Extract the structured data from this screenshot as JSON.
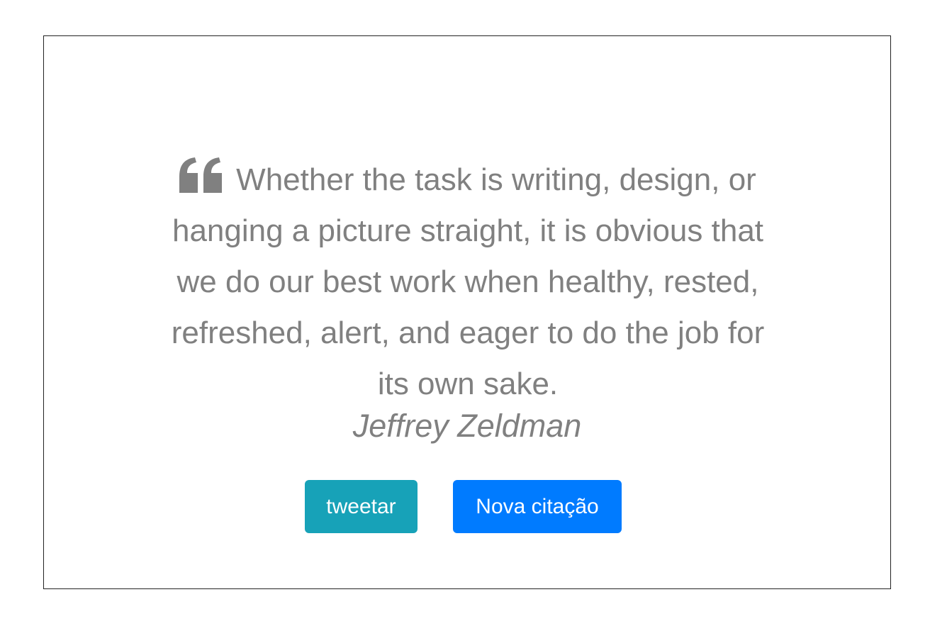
{
  "quote": {
    "icon": "quote-left-icon",
    "text": "Whether the task is writing, design, or hanging a picture straight, it is obvious that we do our best work when healthy, rested, refreshed, alert, and eager to do the job for its own sake.",
    "author": "Jeffrey Zeldman"
  },
  "actions": {
    "tweet_label": "tweetar",
    "new_quote_label": "Nova citação"
  },
  "colors": {
    "text": "#808080",
    "tweet_button": "#17a2b8",
    "new_quote_button": "#007bff",
    "border": "#222222"
  }
}
